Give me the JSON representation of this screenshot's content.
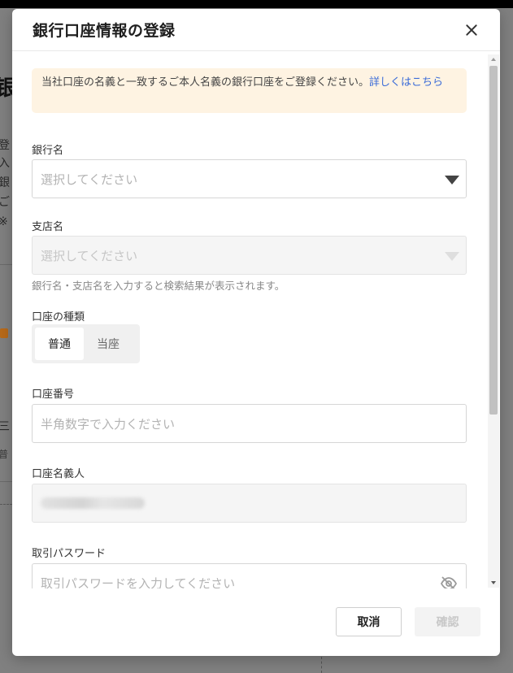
{
  "modal": {
    "title": "銀行口座情報の登録",
    "notice_text": "当社口座の名義と一致するご本人名義の銀行口座をご登録ください。",
    "notice_link": "詳しくはこちら",
    "bank_name": {
      "label": "銀行名",
      "placeholder": "選択してください"
    },
    "branch_name": {
      "label": "支店名",
      "placeholder": "選択してください",
      "hint": "銀行名・支店名を入力すると検索結果が表示されます。"
    },
    "account_type": {
      "label": "口座の種類",
      "options": [
        "普通",
        "当座"
      ],
      "selected": "普通"
    },
    "account_number": {
      "label": "口座番号",
      "placeholder": "半角数字で入力ください"
    },
    "account_holder": {
      "label": "口座名義人"
    },
    "password": {
      "label": "取引パスワード",
      "placeholder": "取引パスワードを入力してください"
    },
    "buttons": {
      "cancel": "取消",
      "confirm": "確認"
    }
  },
  "icons": {
    "close": "close-icon",
    "dropdown": "chevron-down-icon",
    "visibility": "eye-off-icon"
  },
  "colors": {
    "notice_bg": "#fef3e2",
    "link": "#3a6bd8",
    "overlay": "#808080"
  }
}
